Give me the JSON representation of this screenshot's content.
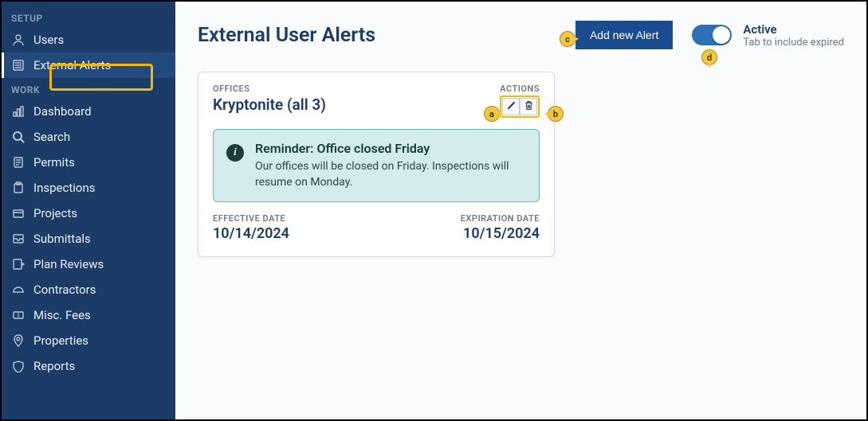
{
  "sidebar": {
    "sections": [
      {
        "label": "SETUP",
        "items": [
          {
            "label": "Users",
            "icon": "user-icon",
            "active": false
          },
          {
            "label": "External Alerts",
            "icon": "list-icon",
            "active": true
          }
        ]
      },
      {
        "label": "WORK",
        "items": [
          {
            "label": "Dashboard",
            "icon": "chart-icon"
          },
          {
            "label": "Search",
            "icon": "search-icon"
          },
          {
            "label": "Permits",
            "icon": "doc-icon"
          },
          {
            "label": "Inspections",
            "icon": "clipboard-icon"
          },
          {
            "label": "Projects",
            "icon": "folder-icon"
          },
          {
            "label": "Submittals",
            "icon": "inbox-icon"
          },
          {
            "label": "Plan Reviews",
            "icon": "review-icon"
          },
          {
            "label": "Contractors",
            "icon": "hardhat-icon"
          },
          {
            "label": "Misc. Fees",
            "icon": "money-icon"
          },
          {
            "label": "Properties",
            "icon": "pin-icon"
          },
          {
            "label": "Reports",
            "icon": "report-icon"
          }
        ]
      }
    ]
  },
  "header": {
    "title": "External User Alerts",
    "add_button": "Add new Alert",
    "toggle": {
      "title": "Active",
      "subtitle": "Tab to include expired",
      "on": true
    }
  },
  "card": {
    "offices_label": "OFFICES",
    "offices_value": "Kryptonite (all 3)",
    "actions_label": "ACTIONS",
    "alert": {
      "title": "Reminder: Office closed Friday",
      "body": "Our offices will be closed on Friday. Inspections will resume on Monday."
    },
    "effective_label": "EFFECTIVE DATE",
    "effective_value": "10/14/2024",
    "expiration_label": "EXPIRATION DATE",
    "expiration_value": "10/15/2024"
  },
  "callouts": {
    "a": "a",
    "b": "b",
    "c": "c",
    "d": "d"
  }
}
